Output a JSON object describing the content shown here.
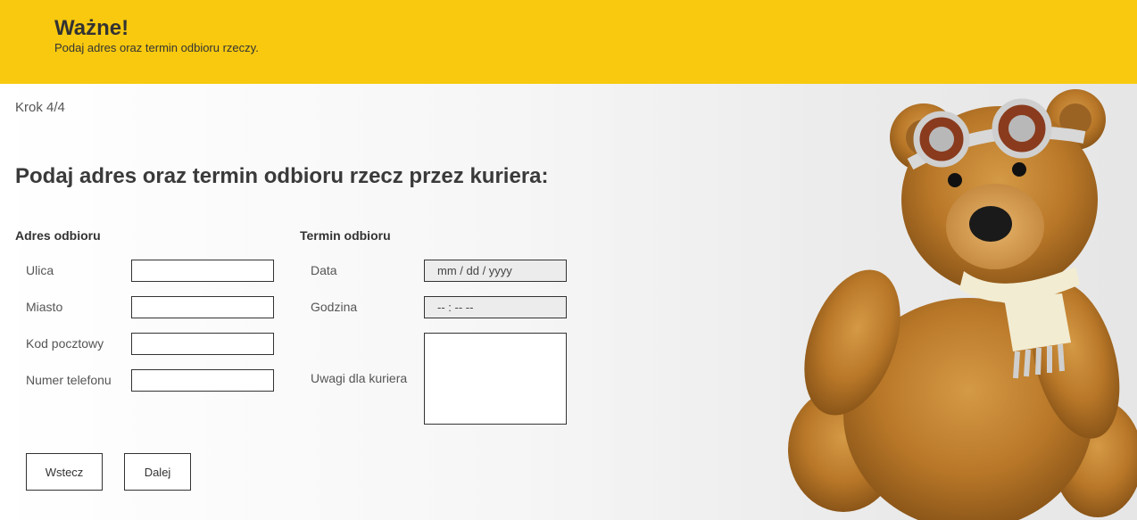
{
  "banner": {
    "title": "Ważne!",
    "subtitle": "Podaj adres oraz termin odbioru rzeczy.",
    "color": "#f8c90f"
  },
  "step": "Krok 4/4",
  "heading": "Podaj adres oraz termin odbioru rzecz przez kuriera:",
  "address": {
    "title": "Adres odbioru",
    "fields": [
      {
        "label": "Ulica",
        "value": ""
      },
      {
        "label": "Miasto",
        "value": ""
      },
      {
        "label": "Kod pocztowy",
        "value": ""
      },
      {
        "label": "Numer telefonu",
        "value": ""
      }
    ]
  },
  "schedule": {
    "title": "Termin odbioru",
    "date_label": "Data",
    "date_placeholder": "mm / dd / yyyy",
    "time_label": "Godzina",
    "time_placeholder": "-- : --  --",
    "notes_label": "Uwagi dla kuriera",
    "notes_value": ""
  },
  "buttons": {
    "back": "Wstecz",
    "next": "Dalej"
  }
}
